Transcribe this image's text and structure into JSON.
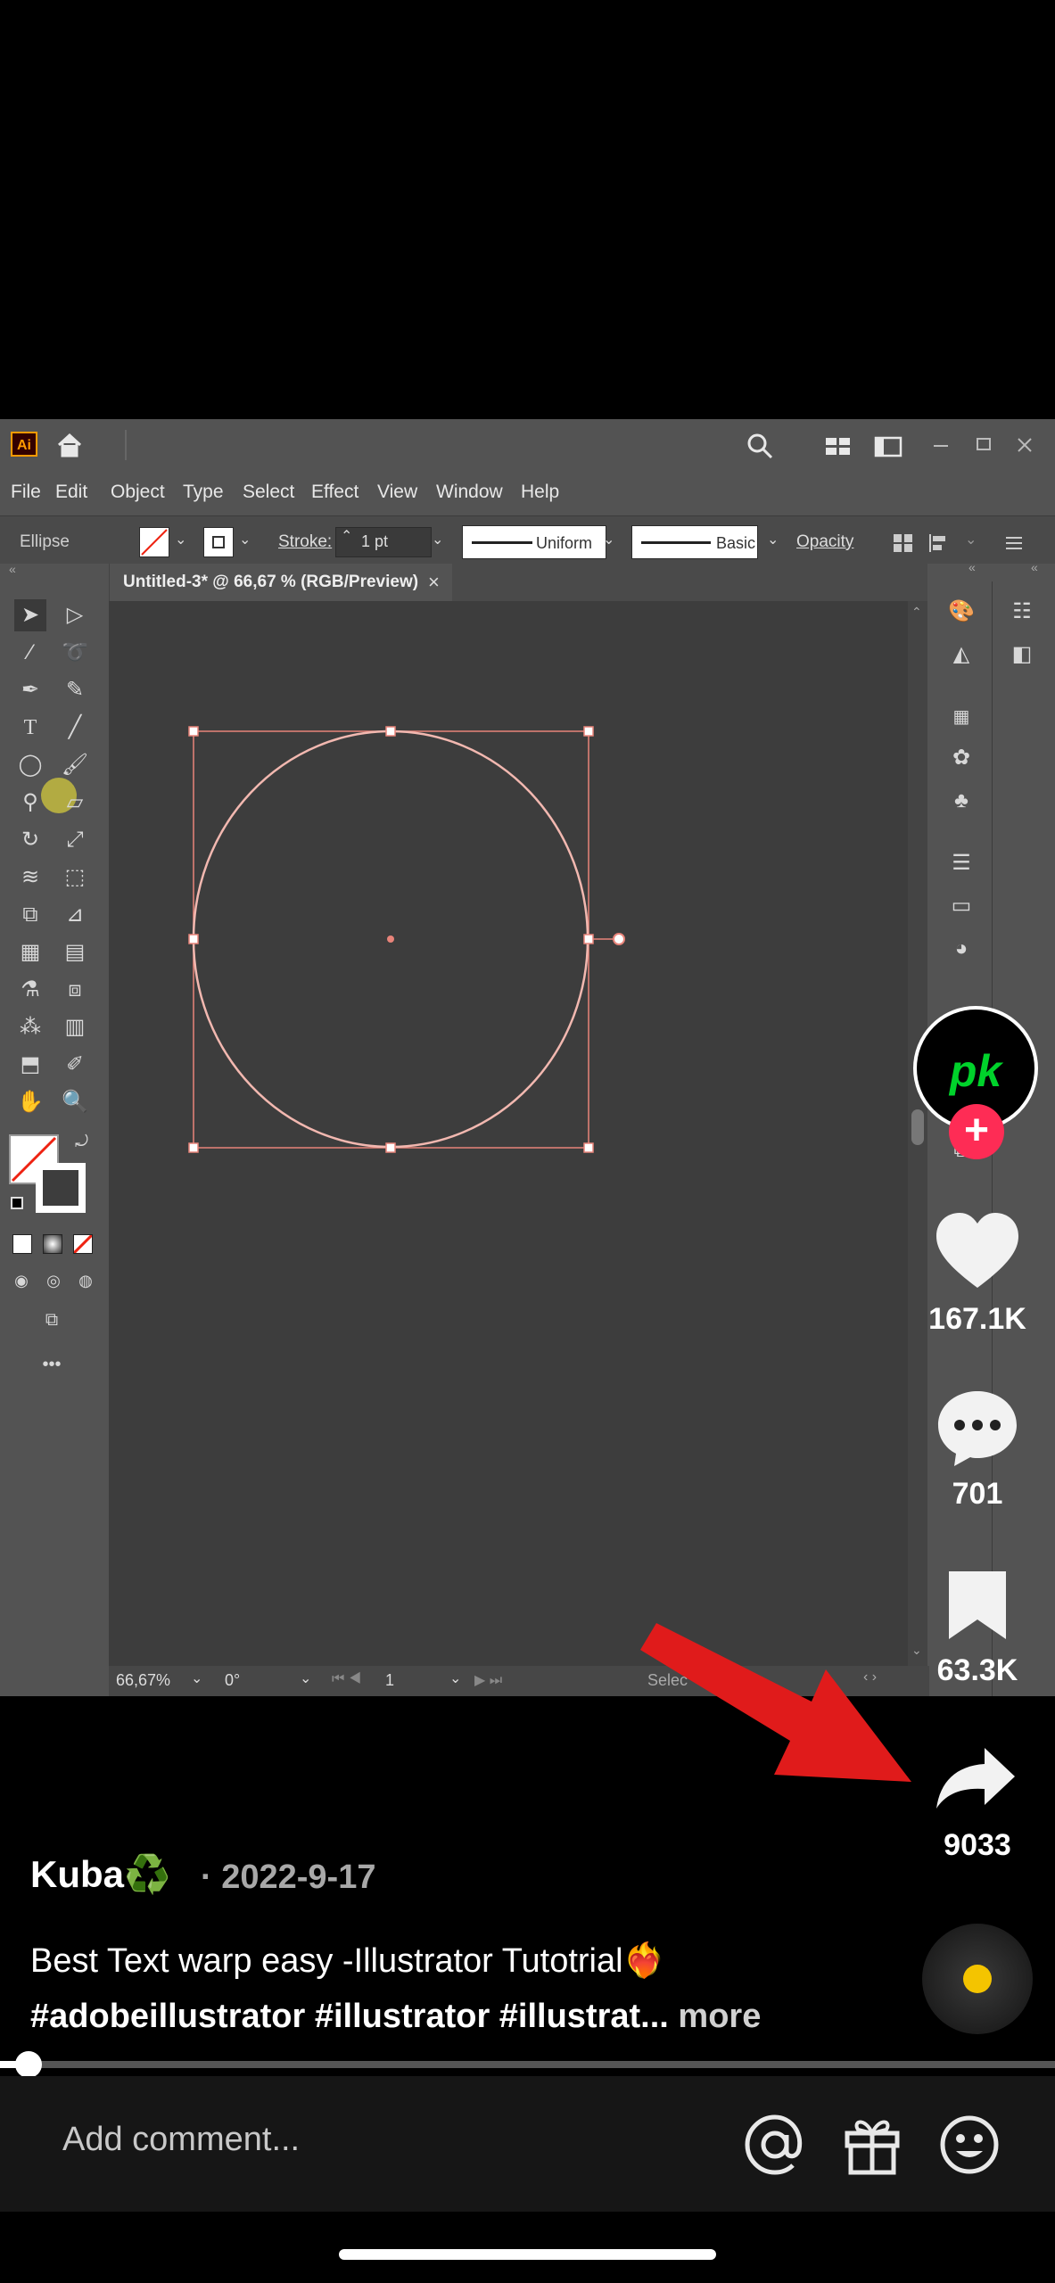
{
  "illustrator": {
    "logo": "Ai",
    "menu": [
      "File",
      "Edit",
      "Object",
      "Type",
      "Select",
      "Effect",
      "View",
      "Window",
      "Help"
    ],
    "control": {
      "object_type": "Ellipse",
      "stroke_label": "Stroke:",
      "stroke_value": "1 pt",
      "profile": "Uniform",
      "brush": "Basic",
      "opacity_label": "Opacity"
    },
    "doc_tab": "Untitled-3* @ 66,67 % (RGB/Preview)",
    "doc_tab_close": "×",
    "status": {
      "zoom": "66,67%",
      "rotation": "0°",
      "artboard": "1",
      "tool": "Selec"
    },
    "icons": [
      "home-icon",
      "search-icon",
      "arrange-icon",
      "window-icon",
      "minimize-icon",
      "maximize-icon",
      "close-icon"
    ],
    "colors": {
      "selection": "#e8847a",
      "shape_stroke": "#f2b8b0"
    }
  },
  "tiktok": {
    "avatar_text": "pk",
    "follow_icon": "+",
    "likes": "167.1K",
    "comments": "701",
    "saves": "63.3K",
    "shares": "9033",
    "username": "Kuba♻️",
    "date": "· 2022-9-17",
    "caption": "Best Text warp easy -Illustrator Tutotrial❤️‍🔥",
    "hashtags": "#adobeillustrator #illustrator #illustrat...",
    "more": "more",
    "comment_placeholder": "Add comment...",
    "colors": {
      "follow": "#fe2c55",
      "arrow": "#e01b1b",
      "avatar_text": "#00d22b"
    }
  }
}
